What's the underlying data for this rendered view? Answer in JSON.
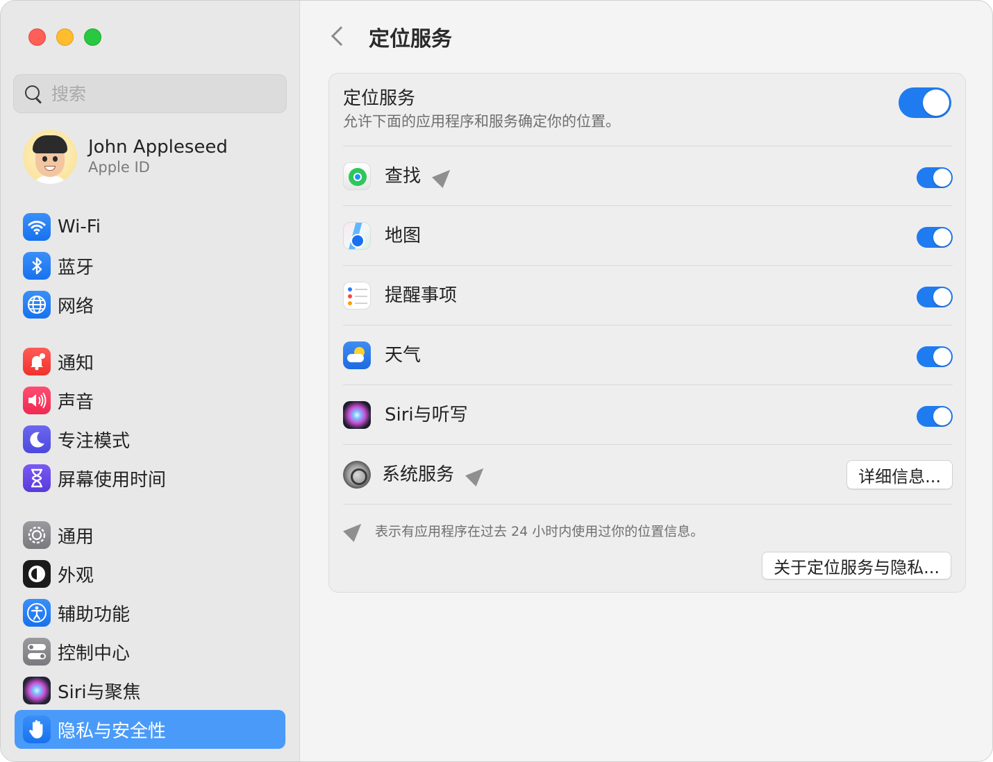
{
  "search": {
    "placeholder": "搜索"
  },
  "profile": {
    "name": "John Appleseed",
    "subtitle": "Apple ID"
  },
  "sidebar": {
    "groups": [
      [
        {
          "label": "Wi-Fi",
          "icon": "wifi-icon"
        },
        {
          "label": "蓝牙",
          "icon": "bluetooth-icon"
        },
        {
          "label": "网络",
          "icon": "globe-icon"
        }
      ],
      [
        {
          "label": "通知",
          "icon": "bell-icon"
        },
        {
          "label": "声音",
          "icon": "speaker-icon"
        },
        {
          "label": "专注模式",
          "icon": "moon-icon"
        },
        {
          "label": "屏幕使用时间",
          "icon": "hourglass-icon"
        }
      ],
      [
        {
          "label": "通用",
          "icon": "gear-icon"
        },
        {
          "label": "外观",
          "icon": "appearance-icon"
        },
        {
          "label": "辅助功能",
          "icon": "accessibility-icon"
        },
        {
          "label": "控制中心",
          "icon": "control-center-icon"
        },
        {
          "label": "Siri与聚焦",
          "icon": "siri-icon"
        },
        {
          "label": "隐私与安全性",
          "icon": "hand-icon",
          "active": true
        }
      ]
    ]
  },
  "header": {
    "title": "定位服务"
  },
  "master": {
    "title": "定位服务",
    "description": "允许下面的应用程序和服务确定你的位置。",
    "enabled": true
  },
  "apps": [
    {
      "label": "查找",
      "icon": "find-my-icon",
      "recent_location": true,
      "enabled": true
    },
    {
      "label": "地图",
      "icon": "maps-icon",
      "recent_location": false,
      "enabled": true
    },
    {
      "label": "提醒事项",
      "icon": "reminders-icon",
      "recent_location": false,
      "enabled": true
    },
    {
      "label": "天气",
      "icon": "weather-icon",
      "recent_location": false,
      "enabled": true
    },
    {
      "label": "Siri与听写",
      "icon": "siri-icon",
      "recent_location": false,
      "enabled": true
    }
  ],
  "system_services": {
    "label": "系统服务",
    "icon": "system-settings-icon",
    "recent_location": true,
    "details_label": "详细信息..."
  },
  "footnote": "表示有应用程序在过去 24 小时内使用过你的位置信息。",
  "about_button": "关于定位服务与隐私...",
  "colors": {
    "accent": "#1f7bf0",
    "sidebar_selected": "#4a9bf9"
  }
}
